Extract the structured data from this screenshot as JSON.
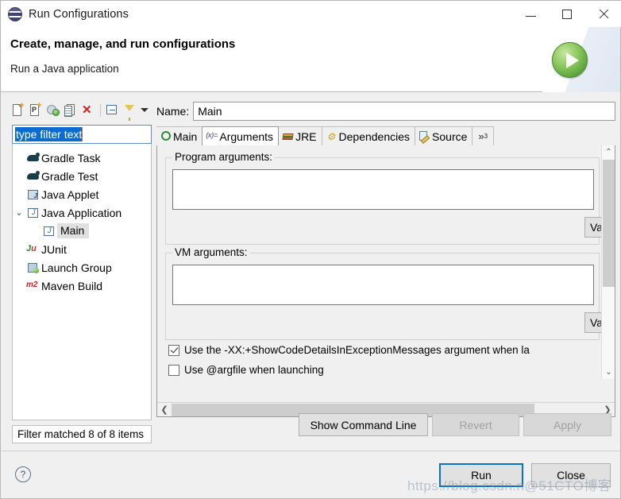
{
  "window": {
    "title": "Run Configurations",
    "icon": "eclipse-icon",
    "minimize_label": "Minimize",
    "maximize_label": "Maximize",
    "close_label": "Close"
  },
  "header": {
    "title": "Create, manage, and run configurations",
    "subtitle": "Run a Java application",
    "banner_icon": "green-run-icon"
  },
  "tree_toolbar": {
    "buttons": [
      {
        "name": "new-configuration-icon",
        "label": "New launch configuration"
      },
      {
        "name": "new-prototype-icon",
        "label": "New prototype"
      },
      {
        "name": "export-icon",
        "label": "Export"
      },
      {
        "name": "duplicate-icon",
        "label": "Duplicate"
      },
      {
        "name": "delete-icon",
        "label": "Delete"
      },
      {
        "name": "collapse-all-icon",
        "label": "Collapse All"
      },
      {
        "name": "filter-icon",
        "label": "Filter launch configurations"
      },
      {
        "name": "chevron-down-icon",
        "label": "View menu"
      }
    ]
  },
  "filter": {
    "value": "type filter text",
    "placeholder": "type filter text",
    "status": "Filter matched 8 of 8 items"
  },
  "tree": {
    "items": [
      {
        "label": "Gradle Task",
        "icon": "gradle-icon",
        "indent": 1,
        "expandable": false,
        "selected": false
      },
      {
        "label": "Gradle Test",
        "icon": "gradle-icon",
        "indent": 1,
        "expandable": false,
        "selected": false
      },
      {
        "label": "Java Applet",
        "icon": "java-applet-icon",
        "indent": 1,
        "expandable": false,
        "selected": false
      },
      {
        "label": "Java Application",
        "icon": "java-app-icon",
        "indent": 1,
        "expandable": true,
        "expanded": true,
        "selected": false
      },
      {
        "label": "Main",
        "icon": "java-app-icon",
        "indent": 2,
        "expandable": false,
        "selected": true
      },
      {
        "label": "JUnit",
        "icon": "junit-icon",
        "indent": 1,
        "expandable": false,
        "selected": false
      },
      {
        "label": "Launch Group",
        "icon": "launch-group-icon",
        "indent": 1,
        "expandable": false,
        "selected": false
      },
      {
        "label": "Maven Build",
        "icon": "maven-icon",
        "indent": 1,
        "expandable": false,
        "selected": false
      }
    ]
  },
  "name_field": {
    "label": "Name:",
    "value": "Main",
    "placeholder": ""
  },
  "tabs": [
    {
      "label": "Main",
      "icon": "main-tab-icon",
      "active": false
    },
    {
      "label": "Arguments",
      "icon": "arguments-tab-icon",
      "active": true
    },
    {
      "label": "JRE",
      "icon": "jre-tab-icon",
      "active": false
    },
    {
      "label": "Dependencies",
      "icon": "dependencies-tab-icon",
      "active": false
    },
    {
      "label": "Source",
      "icon": "source-tab-icon",
      "active": false
    }
  ],
  "tabs_overflow": "»",
  "arguments_tab": {
    "program_arguments": {
      "group_label": "Program arguments:",
      "value": "",
      "variables_button": "Va"
    },
    "vm_arguments": {
      "group_label": "VM arguments:",
      "value": "",
      "variables_button": "Va"
    },
    "checkbox_show_code_details": {
      "label": "Use the -XX:+ShowCodeDetailsInExceptionMessages argument when la",
      "checked": true
    },
    "checkbox_argfile": {
      "label": "Use @argfile when launching",
      "checked": false
    }
  },
  "action_buttons": {
    "show_command_line": {
      "label": "Show Command Line",
      "enabled": true
    },
    "revert": {
      "label": "Revert",
      "enabled": false
    },
    "apply": {
      "label": "Apply",
      "enabled": false
    }
  },
  "footer": {
    "help_icon": "?",
    "run": {
      "label": "Run",
      "default": true
    },
    "close": {
      "label": "Close",
      "default": false
    },
    "watermark": "https://blog.csdn.n@51CTO博客"
  },
  "colors": {
    "accent_blue": "#0a72c8",
    "selection_blue": "#0a6bd0",
    "panel_bg": "#f0f0f0",
    "field_bg": "#ffffff",
    "run_green": "#5ba33c",
    "delete_red": "#d02020"
  }
}
